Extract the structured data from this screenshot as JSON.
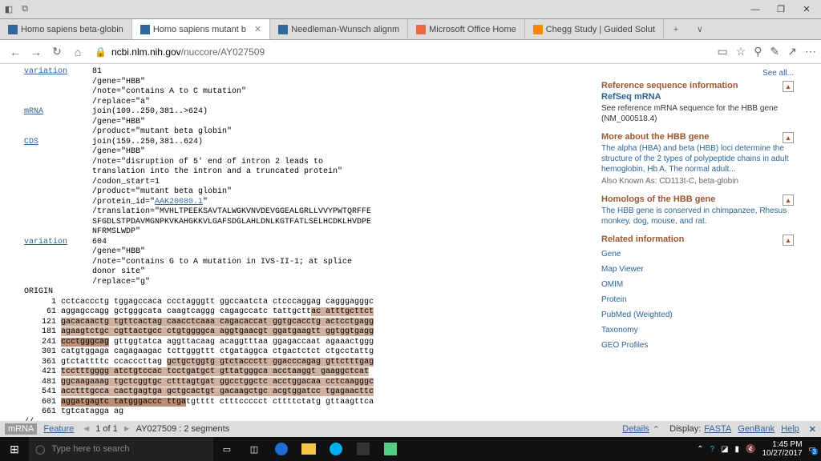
{
  "window": {
    "minimize": "—",
    "maximize": "❐",
    "close": "✕"
  },
  "tabs": {
    "items": [
      {
        "label": "Homo sapiens beta-globin"
      },
      {
        "label": "Homo sapiens mutant b"
      },
      {
        "label": "Needleman-Wunsch alignm"
      },
      {
        "label": "Microsoft Office Home"
      },
      {
        "label": "Chegg Study | Guided Solut"
      }
    ],
    "close": "✕",
    "new": "+",
    "more": "∨"
  },
  "addr": {
    "lock": "🔒",
    "host": "ncbi.nlm.nih.gov",
    "path": "/nuccore/AY027509",
    "book": "▭",
    "star": "☆",
    "pin": "⚲",
    "pen": "✎",
    "share": "↗",
    "more": "⋯",
    "back": "←",
    "fwd": "→",
    "reload": "↻",
    "home": "⌂"
  },
  "feat": {
    "variation1": {
      "k": "variation",
      "pos": "81",
      "l1": "/gene=\"HBB\"",
      "l2": "/note=\"contains A to C mutation\"",
      "l3": "/replace=\"a\""
    },
    "mrna": {
      "k": "mRNA",
      "pos": "join(109..250,381..>624)",
      "l1": "/gene=\"HBB\"",
      "l2": "/product=\"mutant beta globin\""
    },
    "cds": {
      "k": "CDS",
      "pos": "join(159..250,381..624)",
      "l1": "/gene=\"HBB\"",
      "l2": "/note=\"disruption of 5' end of intron 2 leads to",
      "l3": "translation into the intron and a truncated protein\"",
      "l4": "/codon_start=1",
      "l5": "/product=\"mutant beta globin\"",
      "l6pre": "/protein_id=\"",
      "l6link": "AAK20080.1",
      "l6post": "\"",
      "l7": "/translation=\"MVHLTPEEKSAVTALWGKVNVDEVGGEALGRLLVVYPWTQRFFE",
      "l8": "SFGDLSTPDAVMGNPKVKAHGKKVLGAFSDGLAHLDNLKGTFATLSELHCDKLHVDPE",
      "l9": "NFRMSLWDP\""
    },
    "variation2": {
      "k": "variation",
      "pos": "604",
      "l1": "/gene=\"HBB\"",
      "l2": "/note=\"contains G to A mutation in IVS-II-1; at splice",
      "l3": "donor site\"",
      "l4": "/replace=\"g\""
    }
  },
  "origin": {
    "label": "ORIGIN",
    "rows": [
      {
        "n": "1",
        "s": "cctcaccctg tggagccaca ccctagggtt ggccaatcta ctcccaggag cagggagggc"
      },
      {
        "n": "61",
        "s": "aggagccagg gctgggcata caagtcaggg cagagccatc tattgctt",
        "h": "ac atttgcttct"
      },
      {
        "n": "121",
        "h": "gacacaactg tgttcactag caacctcaaa cagacaccat ggtgcacctg actcctgagg"
      },
      {
        "n": "181",
        "h": "agaagtctgc cgttactgcc ctgtggggca aggtgaacgt ggatgaagtt ggtggtgagg"
      },
      {
        "n": "241",
        "h2": "ccctgggcag",
        "s": " gttggtatca aggttacaag acaggtttaa ggagaccaat agaaactggg"
      },
      {
        "n": "301",
        "s": "catgtggaga cagagaagac tcttgggttt ctgataggca ctgactctct ctgcctattg"
      },
      {
        "n": "361",
        "s": "gtctattttc ccacccttag ",
        "h": "gctgctggtg gtctaccctt ggacccagag gttctttgag"
      },
      {
        "n": "421",
        "h": "tcctttgggg atctgtccac tcctgatgct gttatgggca acctaaggt gaaggctcat"
      },
      {
        "n": "481",
        "h": "ggcaagaaag tgctcggtgc ctttagtgat ggcctggctc acctggacaa cctcaagggc"
      },
      {
        "n": "541",
        "h": "acctttgcca cactgagtga gctgcactgt gacaagctgc acgtggatcc tgagaacttc"
      },
      {
        "n": "601",
        "h2": "aggatgagtc tatgggaccc ttga",
        "s": "tgtttt ctttccccct cttttctatg gttaagttca"
      },
      {
        "n": "661",
        "s": "tgtcatagga ag"
      }
    ],
    "end": "//"
  },
  "side": {
    "seeall": "See all...",
    "ref": {
      "title": "Reference sequence information",
      "h": "RefSeq mRNA",
      "p": "See reference mRNA sequence for the HBB gene (NM_000518.4)"
    },
    "more": {
      "title": "More about the HBB gene",
      "p": "The alpha (HBA) and beta (HBB) loci determine the structure of the 2 types of polypeptide chains in adult hemoglobin, Hb A. The normal adult...",
      "sub": "Also Known As: CD113t-C, beta-globin"
    },
    "hom": {
      "title": "Homologs of the HBB gene",
      "p": "The HBB gene is conserved in chimpanzee, Rhesus monkey, dog, mouse, and rat."
    },
    "rel": {
      "title": "Related information",
      "items": [
        "Gene",
        "Map Viewer",
        "OMIM",
        "Protein",
        "PubMed (Weighted)",
        "Taxonomy",
        "GEO Profiles"
      ]
    },
    "caret": "▴"
  },
  "status": {
    "mrna": "mRNA",
    "feature": "Feature",
    "prev": "◄",
    "pos": "1 of 1",
    "next": "►",
    "seg": "AY027509 : 2 segments",
    "details": "Details",
    "dcaret": "⌃",
    "display": "Display:",
    "fasta": "FASTA",
    "genbank": "GenBank",
    "help": "Help",
    "x": "✕"
  },
  "task": {
    "search": "Type here to search",
    "time": "1:45 PM",
    "date": "10/27/2017",
    "badge": "3"
  }
}
